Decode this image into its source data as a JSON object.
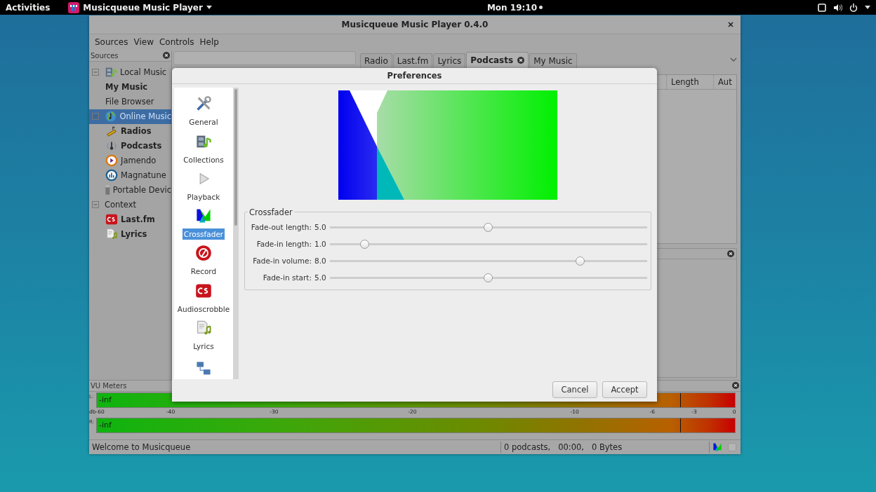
{
  "top_bar": {
    "activities": "Activities",
    "app_name": "Musicqueue Music Player",
    "clock": "Mon 19:10"
  },
  "window": {
    "title": "Musicqueue Music Player 0.4.0"
  },
  "menu": [
    "Sources",
    "View",
    "Controls",
    "Help"
  ],
  "sources_panel": {
    "title": "Sources",
    "tree": [
      {
        "label": "Local Music",
        "selected": false,
        "bold": false,
        "expanded": true,
        "children": [
          {
            "label": "My Music",
            "selected": false,
            "bold": true
          },
          {
            "label": "File Browser",
            "selected": false,
            "bold": false
          }
        ]
      },
      {
        "label": "Online Music",
        "selected": true,
        "bold": false,
        "expanded": true,
        "children": [
          {
            "label": "Radios",
            "selected": false,
            "bold": true
          },
          {
            "label": "Podcasts",
            "selected": false,
            "bold": true
          },
          {
            "label": "Jamendo",
            "selected": false,
            "bold": false
          },
          {
            "label": "Magnatune",
            "selected": false,
            "bold": false
          },
          {
            "label": "Portable Devic",
            "selected": false,
            "bold": false
          }
        ]
      },
      {
        "label": "Context",
        "selected": false,
        "bold": false,
        "expanded": true,
        "children": [
          {
            "label": "Last.fm",
            "selected": false,
            "bold": true
          },
          {
            "label": "Lyrics",
            "selected": false,
            "bold": true
          }
        ]
      }
    ]
  },
  "tabs": [
    {
      "label": "Radio",
      "selected": false,
      "closable": false
    },
    {
      "label": "Last.fm",
      "selected": false,
      "closable": false
    },
    {
      "label": "Lyrics",
      "selected": false,
      "closable": false
    },
    {
      "label": "Podcasts",
      "selected": true,
      "closable": true
    },
    {
      "label": "My Music",
      "selected": false,
      "closable": false
    }
  ],
  "table": {
    "columns": [
      "Length",
      "Aut"
    ]
  },
  "preferences": {
    "title": "Preferences",
    "categories": [
      {
        "label": "General",
        "selected": false
      },
      {
        "label": "Collections",
        "selected": false
      },
      {
        "label": "Playback",
        "selected": false
      },
      {
        "label": "Crossfader",
        "selected": true
      },
      {
        "label": "Record",
        "selected": false
      },
      {
        "label": "Audioscrobble",
        "selected": false
      },
      {
        "label": "Lyrics",
        "selected": false
      }
    ],
    "crossfader": {
      "title": "Crossfader",
      "sliders": [
        {
          "label": "Fade-out length:",
          "value": "5.0",
          "level": 0.5
        },
        {
          "label": "Fade-in length:",
          "value": "1.0",
          "level": 0.11
        },
        {
          "label": "Fade-in volume:",
          "value": "8.0",
          "level": 0.79
        },
        {
          "label": "Fade-in start:",
          "value": "5.0",
          "level": 0.5
        }
      ]
    },
    "buttons": [
      "Cancel",
      "Accept"
    ]
  },
  "vu_meters": {
    "title": "VU Meters",
    "channels": [
      {
        "label": "L:",
        "reading": "-inf"
      },
      {
        "label": "R:",
        "reading": "-inf"
      }
    ],
    "scale": [
      "db-60",
      "-40",
      "-30",
      "-20",
      "-10",
      "-6",
      "-3",
      "0"
    ]
  },
  "status_bar": {
    "message": "Welcome to Musicqueue",
    "podcasts": "0 podcasts,",
    "time": "00:00,",
    "size": "0 Bytes"
  }
}
